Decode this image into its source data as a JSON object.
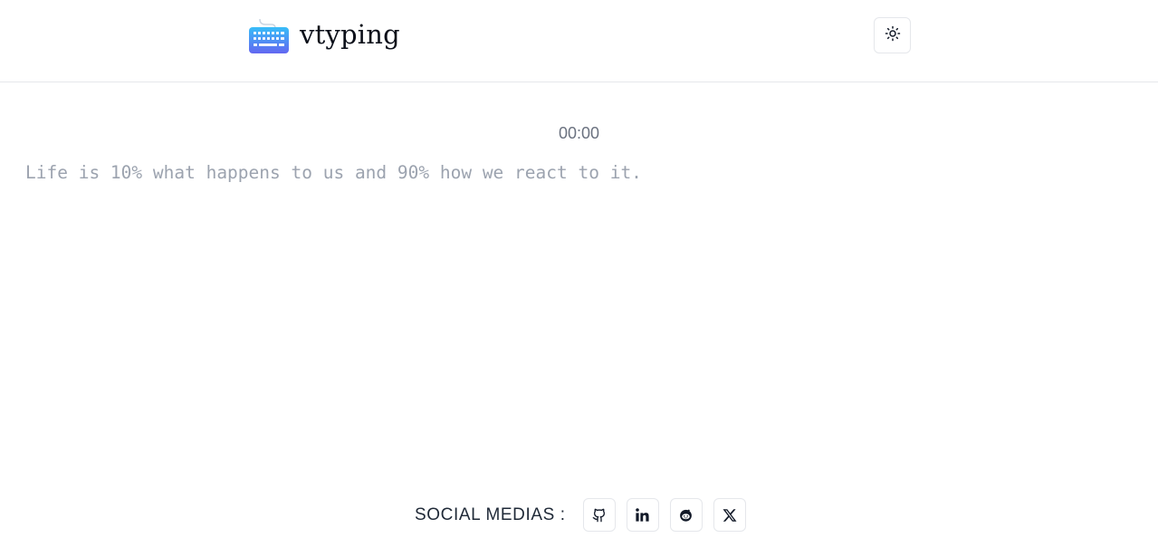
{
  "header": {
    "brand_name": "vtyping",
    "logo_icon": "keyboard-icon",
    "theme_toggle_icon": "sun-icon"
  },
  "main": {
    "timer": "00:00",
    "quote": "Life is 10% what happens to us and 90% how we react to it."
  },
  "footer": {
    "label": "SOCIAL MEDIAS :",
    "links": [
      {
        "icon": "github-icon"
      },
      {
        "icon": "linkedin-icon"
      },
      {
        "icon": "reddit-icon"
      },
      {
        "icon": "x-icon"
      }
    ]
  },
  "colors": {
    "logo_gradient_top": "#38bdf8",
    "logo_gradient_bottom": "#6366f1",
    "quote_text": "#9ca3af",
    "timer_text": "#6b7280"
  }
}
